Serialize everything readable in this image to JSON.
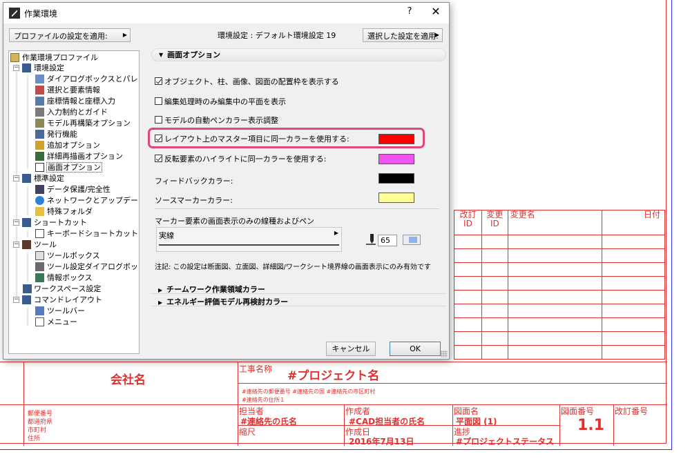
{
  "dialog": {
    "title": "作業環境",
    "help": "?",
    "close": "✕",
    "apply_profile_button": "プロファイルの設定を適用:",
    "env_setting_label": "環境設定 : デフォルト環境設定 19",
    "apply_selected_button": "選択した設定を適用:",
    "cancel_button": "キャンセル",
    "ok_button": "OK"
  },
  "tree": {
    "root": "作業環境プロファイル",
    "groups": [
      {
        "label": "環境設定",
        "children": [
          "ダイアログボックスとパレット",
          "選択と要素情報",
          "座標情報と座標入力",
          "入力制約とガイド",
          "モデル再構築オプション",
          "発行機能",
          "追加オプション",
          "詳細再描画オプション",
          "画面オプション"
        ]
      },
      {
        "label": "標準設定",
        "children": [
          "データ保護/完全性",
          "ネットワークとアップデート",
          "特殊フォルダ"
        ]
      },
      {
        "label": "ショートカット",
        "children": [
          "キーボードショートカット"
        ]
      },
      {
        "label": "ツール",
        "children": [
          "ツールボックス",
          "ツール設定ダイアログボックス",
          "情報ボックス"
        ]
      },
      {
        "label": "ワークスペース設定",
        "children": []
      },
      {
        "label": "コマンドレイアウト",
        "children": [
          "ツールバー",
          "メニュー"
        ]
      }
    ]
  },
  "options": {
    "section_title": "画面オプション",
    "checks": [
      {
        "label": "オブジェクト、柱、画像、図面の配置枠を表示する",
        "checked": true
      },
      {
        "label": "編集処理時のみ編集中の平面を表示",
        "checked": false
      },
      {
        "label": "モデルの自動ペンカラー表示調整",
        "checked": false
      },
      {
        "label": "レイアウト上のマスター項目に同一カラーを使用する:",
        "checked": true
      },
      {
        "label": "反転要素のハイライトに同一カラーを使用する:",
        "checked": true
      }
    ],
    "feedback_label": "フィードバックカラー:",
    "source_marker_label": "ソースマーカーカラー:",
    "marker_line_label": "マーカー要素の画面表示のみの線種およびペン",
    "line_type_value": "実線",
    "pen_number": "65",
    "note": "注記: この設定は断面図、立面図、詳細図/ワークシート境界線の画面表示にのみ有効です",
    "teamwork_section": "チームワーク作業領域カラー",
    "energy_section": "エネルギー評価モデル再検討カラー",
    "colors": {
      "master": "#ff0000",
      "highlight": "#ee55ee",
      "feedback": "#000000",
      "source_marker": "#ffff99",
      "highlight_frame": "#e0457a"
    }
  },
  "sheet": {
    "revision_headers": [
      "改訂\nID",
      "変更\nID",
      "変更名",
      "日付"
    ],
    "company": "会社名",
    "project_label": "工事名称",
    "project_name": "#プロジェクト名",
    "contact_line1": "#連絡先の郵便番号 #連絡先の国 #連絡先の市区町村",
    "contact_line2": "#連絡先の住所１",
    "address_lines": [
      "郵便番号",
      "都道府県",
      "市町村",
      "住所"
    ],
    "person_label": "担当者",
    "person_value": "#連絡先の氏名",
    "scale_label": "縮尺",
    "author_label": "作成者",
    "author_value": "#CAD担当者の氏名",
    "date_label": "作成日",
    "date_value": "2016年7月13日",
    "drawing_label": "図面名",
    "drawing_value": "平面図 (1)",
    "progress_label": "進捗",
    "progress_value": "#プロジェクトステータス",
    "drawing_no_label": "図面番号",
    "drawing_no_value": "1.1",
    "revision_no_label": "改訂番号"
  }
}
